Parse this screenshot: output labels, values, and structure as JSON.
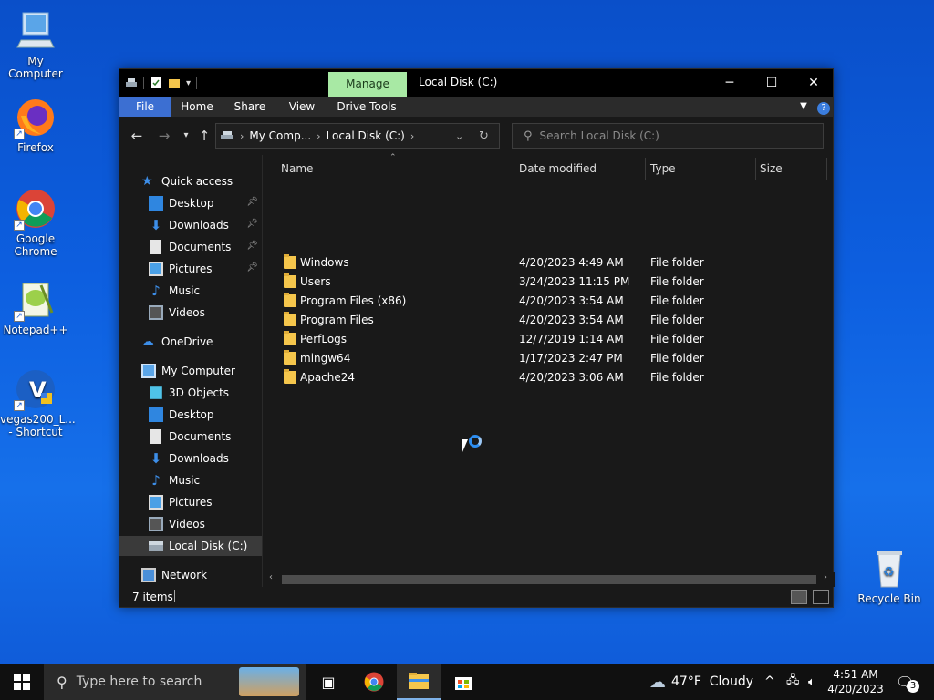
{
  "desktop": {
    "icons": [
      {
        "label": "My Computer"
      },
      {
        "label": "Firefox"
      },
      {
        "label": "Google Chrome"
      },
      {
        "label": "Notepad++"
      },
      {
        "label": "vegas200_L... - Shortcut"
      },
      {
        "label": "Recycle Bin"
      }
    ]
  },
  "window": {
    "title": "Local Disk (C:)",
    "manage_tab": "Manage",
    "ribbon_tabs": [
      "File",
      "Home",
      "Share",
      "View",
      "Drive Tools"
    ],
    "address": {
      "crumbs": [
        "My Comp...",
        "Local Disk (C:)"
      ]
    },
    "search": {
      "placeholder": "Search Local Disk (C:)"
    },
    "nav": {
      "quick_access": "Quick access",
      "quick_items": [
        "Desktop",
        "Downloads",
        "Documents",
        "Pictures",
        "Music",
        "Videos"
      ],
      "onedrive": "OneDrive",
      "my_computer": "My Computer",
      "pc_items": [
        "3D Objects",
        "Desktop",
        "Documents",
        "Downloads",
        "Music",
        "Pictures",
        "Videos",
        "Local Disk (C:)"
      ],
      "network": "Network"
    },
    "columns": [
      "Name",
      "Date modified",
      "Type",
      "Size"
    ],
    "files": [
      {
        "name": "Windows",
        "date": "4/20/2023 4:49 AM",
        "type": "File folder"
      },
      {
        "name": "Users",
        "date": "3/24/2023 11:15 PM",
        "type": "File folder"
      },
      {
        "name": "Program Files (x86)",
        "date": "4/20/2023 3:54 AM",
        "type": "File folder"
      },
      {
        "name": "Program Files",
        "date": "4/20/2023 3:54 AM",
        "type": "File folder"
      },
      {
        "name": "PerfLogs",
        "date": "12/7/2019 1:14 AM",
        "type": "File folder"
      },
      {
        "name": "mingw64",
        "date": "1/17/2023 2:47 PM",
        "type": "File folder"
      },
      {
        "name": "Apache24",
        "date": "4/20/2023 3:06 AM",
        "type": "File folder"
      }
    ],
    "status": "7 items"
  },
  "taskbar": {
    "search_placeholder": "Type here to search",
    "weather": "47°F  Cloudy",
    "time": "4:51 AM",
    "date": "4/20/2023",
    "notifications": "3"
  }
}
